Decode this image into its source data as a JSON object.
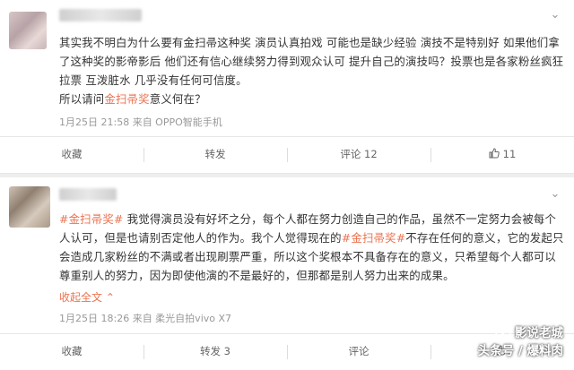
{
  "comments": [
    {
      "text_parts": [
        {
          "text": "其实我不明白为什么要有金扫帚这种奖 演员认真拍戏 可能也是缺少经验 演技不是特别好 如果他们拿了这种奖的影帝影后 他们还有信心继续努力得到观众认可 提升自己的演技吗？投票也是各家粉丝疯狂拉票 互泼脏水 几乎没有任何可信度。",
          "highlight": false
        },
        {
          "text": "所以请问",
          "highlight": false
        },
        {
          "text": "金扫帚奖",
          "highlight": true
        },
        {
          "text": "意义何在？",
          "highlight": false
        }
      ],
      "meta": "1月25日 21:58 来自 OPPO智能手机",
      "actions": {
        "favorite": "收藏",
        "repost": "转发",
        "comment": "评论 12",
        "like": "11"
      }
    },
    {
      "text_parts": [
        {
          "text": "#金扫帚奖#",
          "highlight": true
        },
        {
          "text": " 我觉得演员没有好坏之分，每个人都在努力创造自己的作品，虽然不一定努力会被每个人认可，但是也请别否定他人的作为。我个人觉得现在的",
          "highlight": false
        },
        {
          "text": "#金扫帚奖#",
          "highlight": true
        },
        {
          "text": "不存在任何的意义，它的发起只会造成几家粉丝的不满或者出现刷票严重，所以这个奖根本不具备存在的意义，只希望每个人都可以尊重别人的努力，因为即使他演的不是最好的，但那都是别人努力出来的成果。",
          "highlight": false
        }
      ],
      "expand_label": "收起全文",
      "meta": "1月25日 18:26 来自 柔光自拍vivo X7",
      "actions": {
        "favorite": "收藏",
        "repost": "转发 3",
        "comment": "评论",
        "like": ""
      }
    }
  ],
  "watermark": {
    "line1": "影说老城",
    "line2": "头条号 / 爆料肉"
  },
  "colors": {
    "accent": "#eb7350",
    "background": "#eeeeee"
  }
}
